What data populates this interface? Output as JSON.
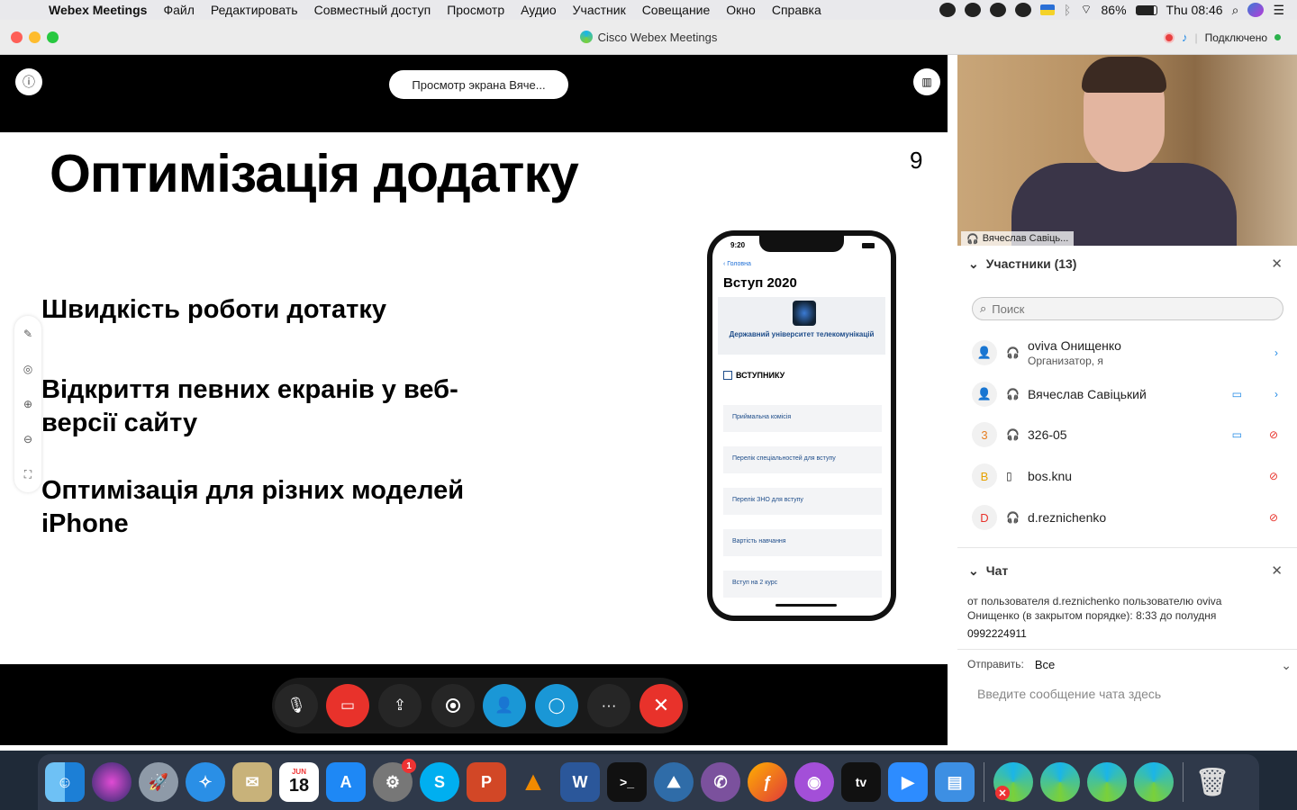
{
  "menubar": {
    "app": "Webex Meetings",
    "items": [
      "Файл",
      "Редактировать",
      "Совместный доступ",
      "Просмотр",
      "Аудио",
      "Участник",
      "Совещание",
      "Окно",
      "Справка"
    ],
    "battery": "86%",
    "clock": "Thu 08:46"
  },
  "window": {
    "title": "Cisco Webex Meetings",
    "status": "Подключено"
  },
  "stage": {
    "view_label": "Просмотр экрана Вяче..."
  },
  "slide": {
    "title": "Оптимізація додатку",
    "number": "9",
    "bullets": [
      "Швидкість роботи дотатку",
      "Відкриття певних екранів у веб-версії сайту",
      "Оптимізація для різних моделей iPhone"
    ],
    "phone": {
      "time": "9:20",
      "back": "Головна",
      "header": "Вступ 2020",
      "university": "Державний університет телекомунікацій",
      "checkbox": "ВСТУПНИКУ",
      "items": [
        "Приймальна комісія",
        "Перелік спеціальностей для вступу",
        "Перелік ЗНО для вступу",
        "Вартість навчання",
        "Вступ на 2 курс"
      ]
    }
  },
  "video": {
    "name": "Вячеслав Савіць..."
  },
  "participants": {
    "header": "Участники (13)",
    "search_placeholder": "Поиск",
    "list": [
      {
        "initial": "",
        "name": "oviva Онищенко",
        "role": "Организатор, я"
      },
      {
        "initial": "",
        "name": "Вячеслав Савіцький",
        "role": ""
      },
      {
        "initial": "3",
        "name": "326-05",
        "role": ""
      },
      {
        "initial": "B",
        "name": "bos.knu",
        "role": ""
      },
      {
        "initial": "D",
        "name": "d.reznichenko",
        "role": ""
      }
    ]
  },
  "chat": {
    "header": "Чат",
    "message": "от пользователя d.reznichenko пользователю oviva Онищенко (в закрытом порядке):    8:33  до полудня",
    "text": "0992224911",
    "send_to_label": "Отправить:",
    "send_to_value": "Все",
    "input_placeholder": "Введите сообщение чата здесь"
  },
  "dock": {
    "calendar_month": "JUN",
    "calendar_day": "18",
    "settings_badge": "1",
    "tv_label": "tv"
  },
  "colors": {
    "accent_blue": "#1a97d6",
    "end_red": "#e8322b",
    "webex_green": "#2bb24c"
  }
}
